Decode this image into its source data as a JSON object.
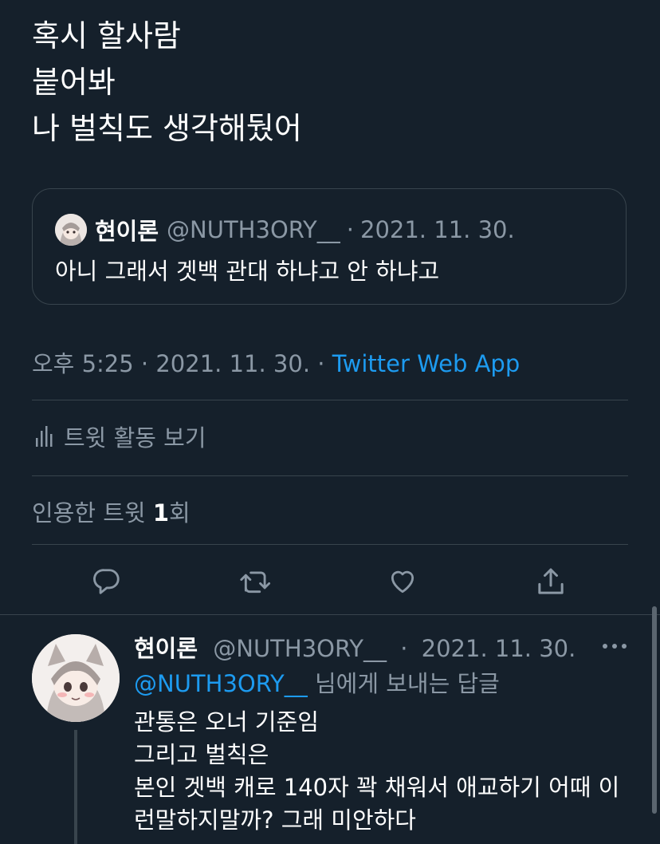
{
  "tweet": {
    "lines": [
      "혹시 할사람",
      "붙어봐",
      "나 벌칙도 생각해뒀어"
    ]
  },
  "quote": {
    "name": "현이론",
    "handle": "@NUTH3ORY__",
    "separator": "·",
    "date": "2021. 11. 30.",
    "text": "아니 그래서 겟백 관대 하냐고 안 하냐고"
  },
  "meta": {
    "time_date": "오후 5:25 · 2021. 11. 30. ·",
    "source": "Twitter Web App"
  },
  "activity": {
    "label": "트윗 활동 보기",
    "icon": "bar-chart-icon"
  },
  "quote_count": {
    "prefix": "인용한 트윗 ",
    "count": "1",
    "suffix": "회"
  },
  "actions": [
    {
      "name": "reply-icon"
    },
    {
      "name": "retweet-icon"
    },
    {
      "name": "like-icon"
    },
    {
      "name": "share-icon"
    }
  ],
  "reply": {
    "name": "현이론",
    "handle": "@NUTH3ORY__",
    "separator": "·",
    "date": "2021. 11. 30.",
    "replying_to_handle": "@NUTH3ORY__",
    "replying_to_suffix": " 님에게 보내는 답글",
    "lines": [
      "관통은 오너 기준임",
      "그리고 벌칙은",
      "본인 겟백 캐로 140자 꽉 채워서 애교하기 어때 이",
      "런말하지말까? 그래 미안하다"
    ]
  },
  "colors": {
    "background": "#15202b",
    "accent": "#1d9bf0",
    "muted": "#8b98a5",
    "divider": "#38444d"
  }
}
